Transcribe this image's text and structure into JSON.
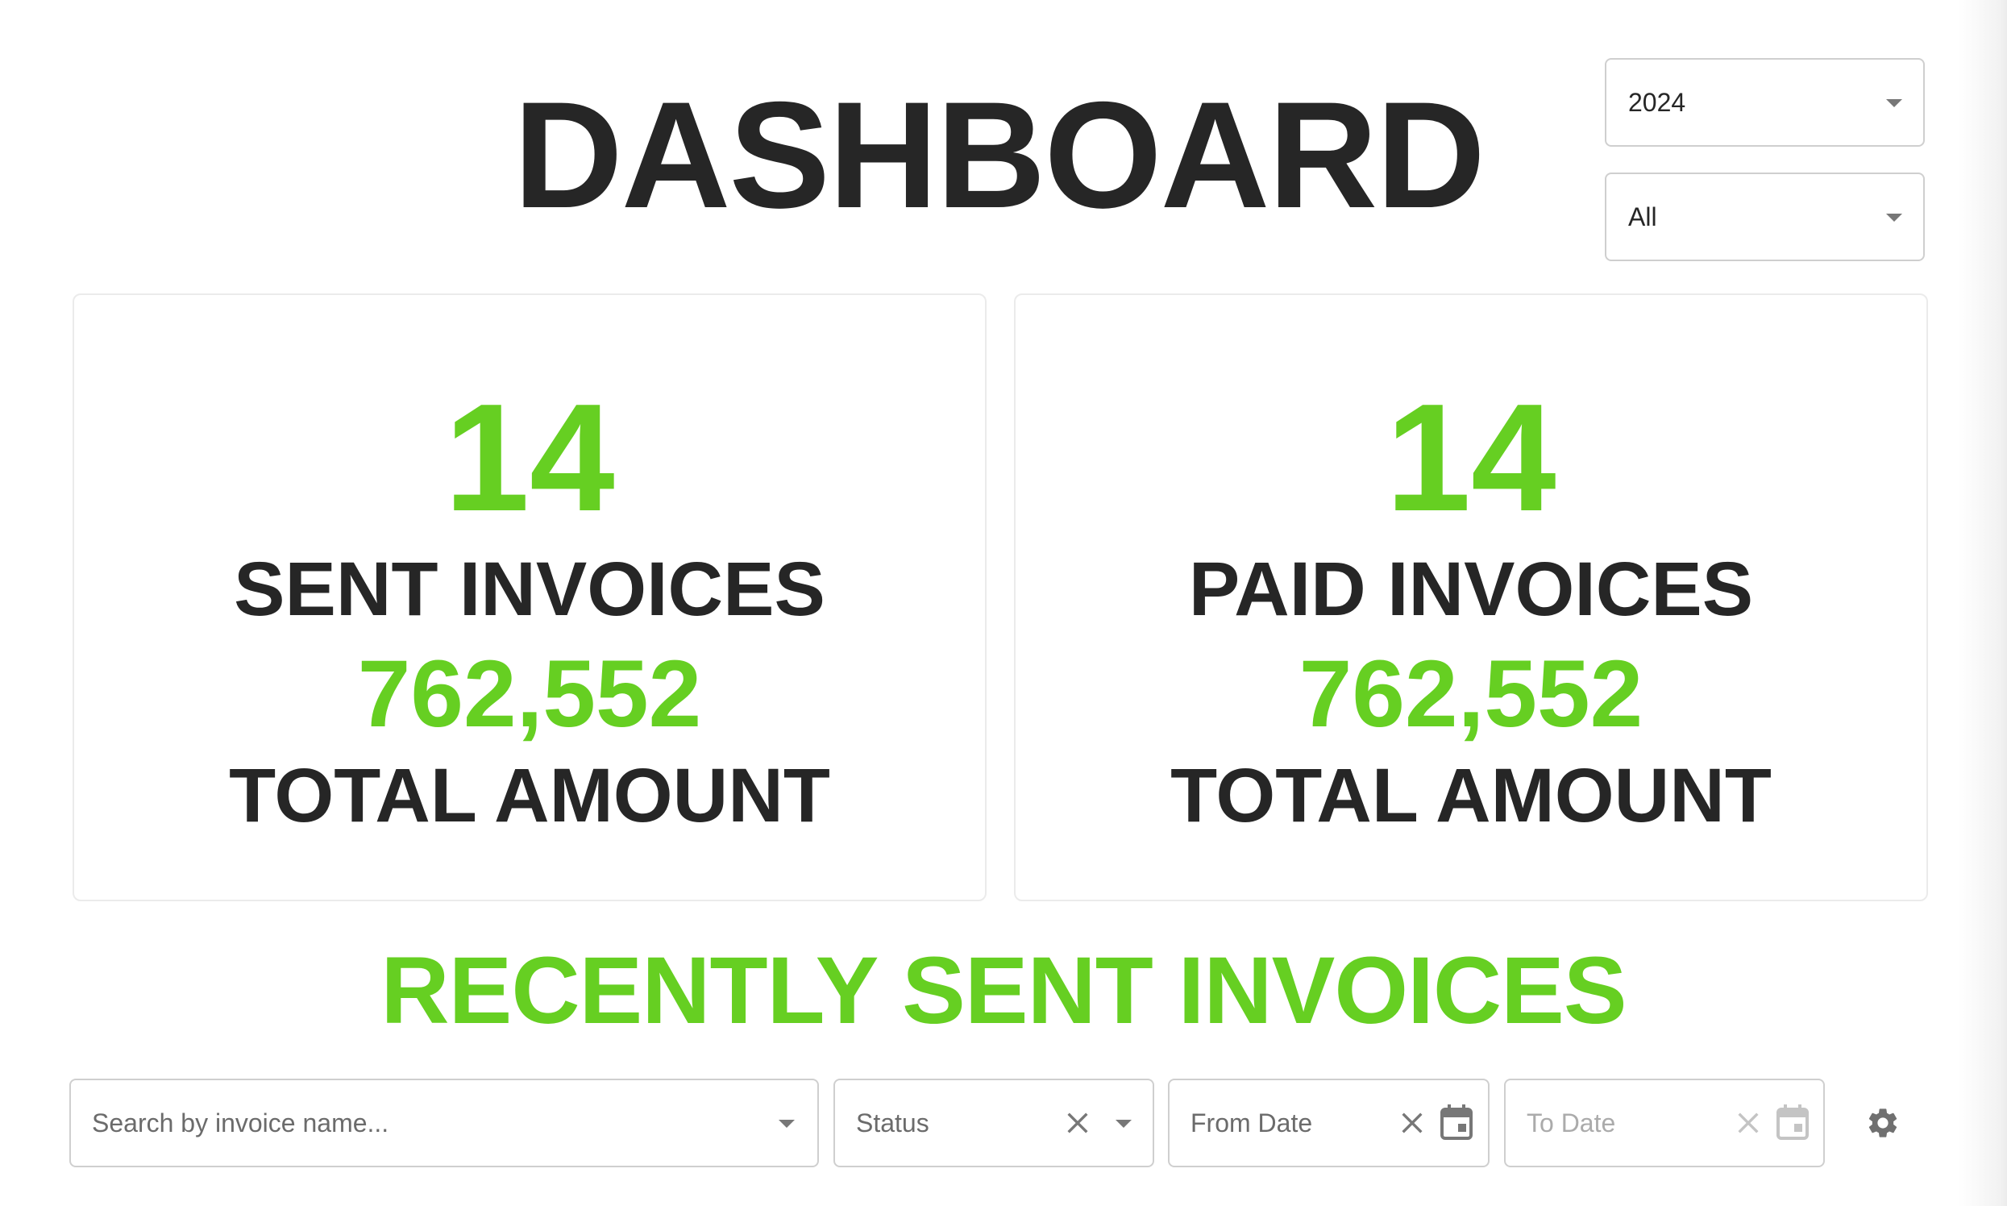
{
  "header": {
    "title": "DASHBOARD"
  },
  "filters": {
    "year": {
      "selected": "2024"
    },
    "scope": {
      "selected": "All"
    }
  },
  "cards": [
    {
      "count": "14",
      "count_label": "SENT INVOICES",
      "amount": "762,552",
      "amount_label": "TOTAL AMOUNT"
    },
    {
      "count": "14",
      "count_label": "PAID INVOICES",
      "amount": "762,552",
      "amount_label": "TOTAL AMOUNT"
    }
  ],
  "recent": {
    "heading": "RECENTLY SENT INVOICES",
    "search_placeholder": "Search by invoice name...",
    "status_placeholder": "Status",
    "from_date_placeholder": "From Date",
    "to_date_placeholder": "To Date"
  },
  "icons": {
    "dropdown": "chevron-down-icon",
    "clear": "close-icon",
    "calendar": "calendar-icon",
    "settings": "gear-icon"
  },
  "colors": {
    "accent": "#66cf22",
    "text": "#262626",
    "muted": "#6b6b6b",
    "disabled": "#ababab",
    "border": "#cfcfcf"
  }
}
